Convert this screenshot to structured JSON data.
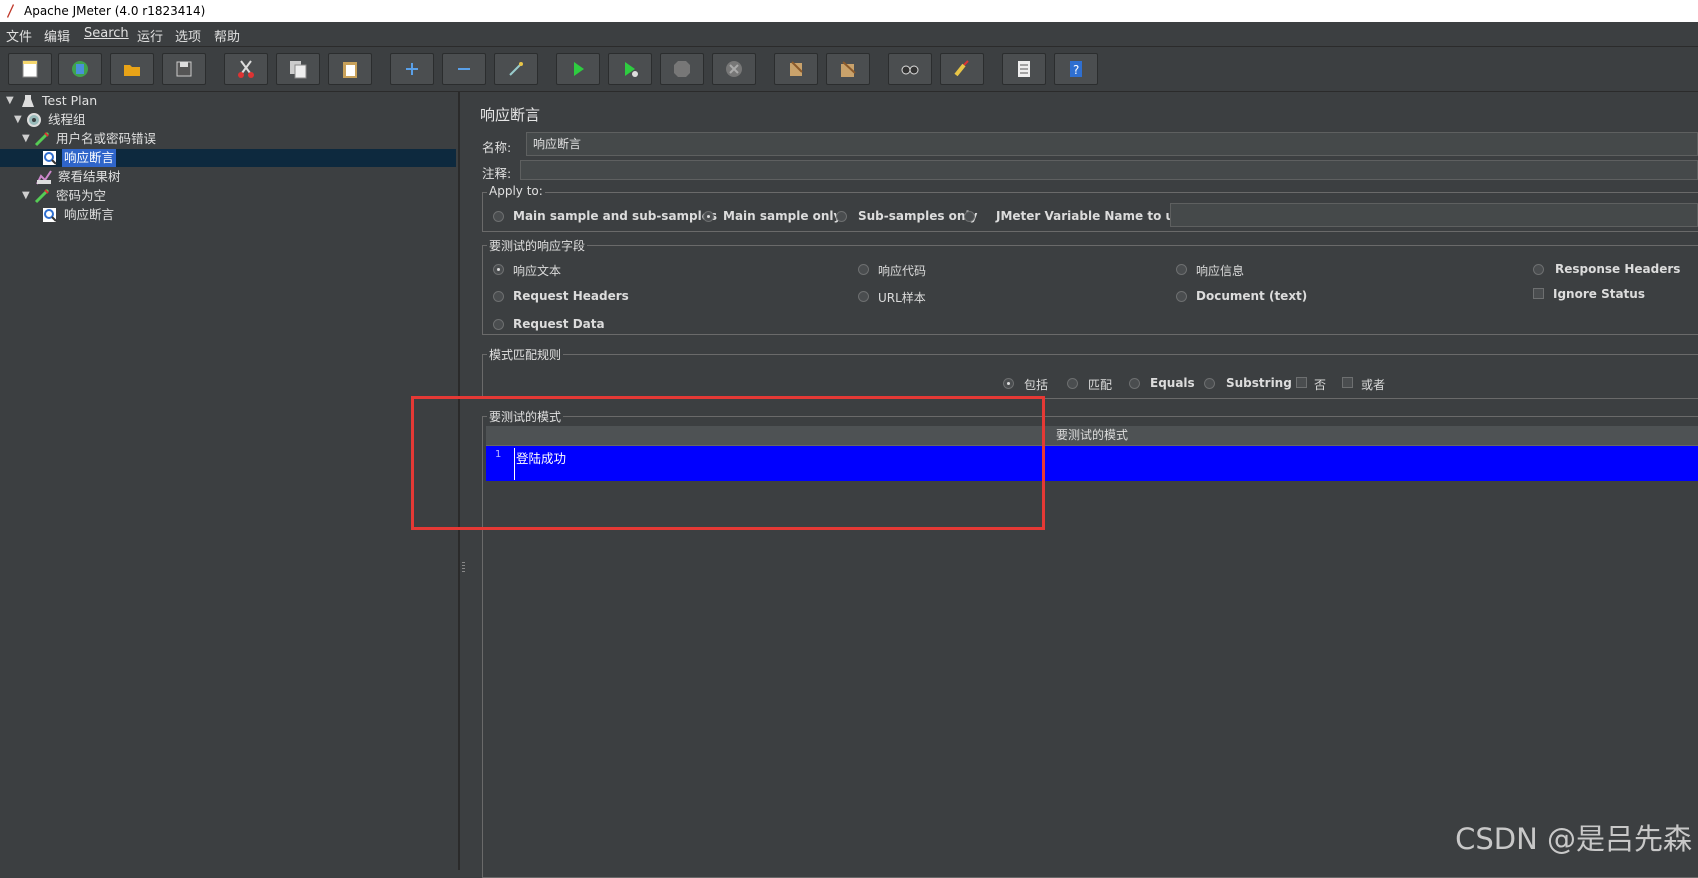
{
  "window": {
    "title": "Apache JMeter (4.0 r1823414)"
  },
  "menu": [
    "文件",
    "编辑",
    "Search",
    "运行",
    "选项",
    "帮助"
  ],
  "toolbar_icons": [
    "new-icon",
    "templates-icon",
    "open-icon",
    "save-icon",
    "cut-icon",
    "copy-icon",
    "paste-icon",
    "expand-icon",
    "collapse-icon",
    "toggle-icon",
    "start-icon",
    "start-no-pauses-icon",
    "stop-icon",
    "shutdown-icon",
    "clear-icon",
    "clear-all-icon",
    "search-icon",
    "reset-search-icon",
    "function-helper-icon",
    "help-icon"
  ],
  "tree": {
    "items": [
      {
        "label": "Test Plan",
        "icon": "test-plan-icon"
      },
      {
        "label": "线程组",
        "icon": "thread-group-icon"
      },
      {
        "label": "用户名或密码错误",
        "icon": "sampler-icon"
      },
      {
        "label": "响应断言",
        "icon": "assertion-icon",
        "selected": true
      },
      {
        "label": "察看结果树",
        "icon": "listener-icon"
      },
      {
        "label": "密码为空",
        "icon": "sampler-icon"
      },
      {
        "label": "响应断言",
        "icon": "assertion-icon"
      }
    ]
  },
  "panel": {
    "heading": "响应断言",
    "name_label": "名称:",
    "name_value": "响应断言",
    "comment_label": "注释:",
    "comment_value": "",
    "apply_to": {
      "title": "Apply to:",
      "options": [
        "Main sample and sub-samples",
        "Main sample only",
        "Sub-samples only",
        "JMeter Variable Name to use"
      ],
      "selected": "Main sample only",
      "variable_value": ""
    },
    "field": {
      "title": "要测试的响应字段",
      "options": [
        "响应文本",
        "响应代码",
        "响应信息",
        "Response Headers",
        "Request Headers",
        "URL样本",
        "Document (text)",
        "Request Data"
      ],
      "selected": "响应文本",
      "ignore_status_label": "Ignore Status",
      "ignore_status": false
    },
    "matching": {
      "title": "模式匹配规则",
      "options": [
        "包括",
        "匹配",
        "Equals",
        "Substring"
      ],
      "selected": "包括",
      "not_label": "否",
      "or_label": "或者"
    },
    "patterns": {
      "title": "要测试的模式",
      "column_header": "要测试的模式",
      "rows": [
        {
          "line": "1",
          "text": "登陆成功"
        }
      ]
    }
  },
  "watermark": "CSDN @是吕先森",
  "colors": {
    "background": "#3c3f41",
    "selection": "#2f65ca",
    "table_selection": "#0000ff",
    "highlight_box": "#e53935"
  }
}
